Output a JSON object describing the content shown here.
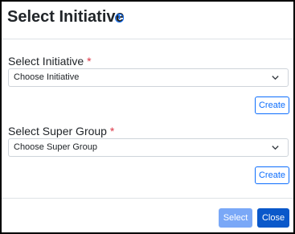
{
  "dialog": {
    "title": "Select Initiative",
    "info_icon": "info-icon"
  },
  "initiative": {
    "label": "Select Initiative",
    "required_mark": "*",
    "value": "Choose Initiative",
    "create_label": "Create"
  },
  "super_group": {
    "label": "Select Super Group",
    "required_mark": "*",
    "value": "Choose Super Group",
    "create_label": "Create"
  },
  "footer": {
    "select_label": "Select",
    "close_label": "Close"
  },
  "colors": {
    "primary": "#0d6efd",
    "primary_disabled": "#7aa8f7",
    "close_bg": "#0a58ca",
    "required": "#dc3545"
  }
}
